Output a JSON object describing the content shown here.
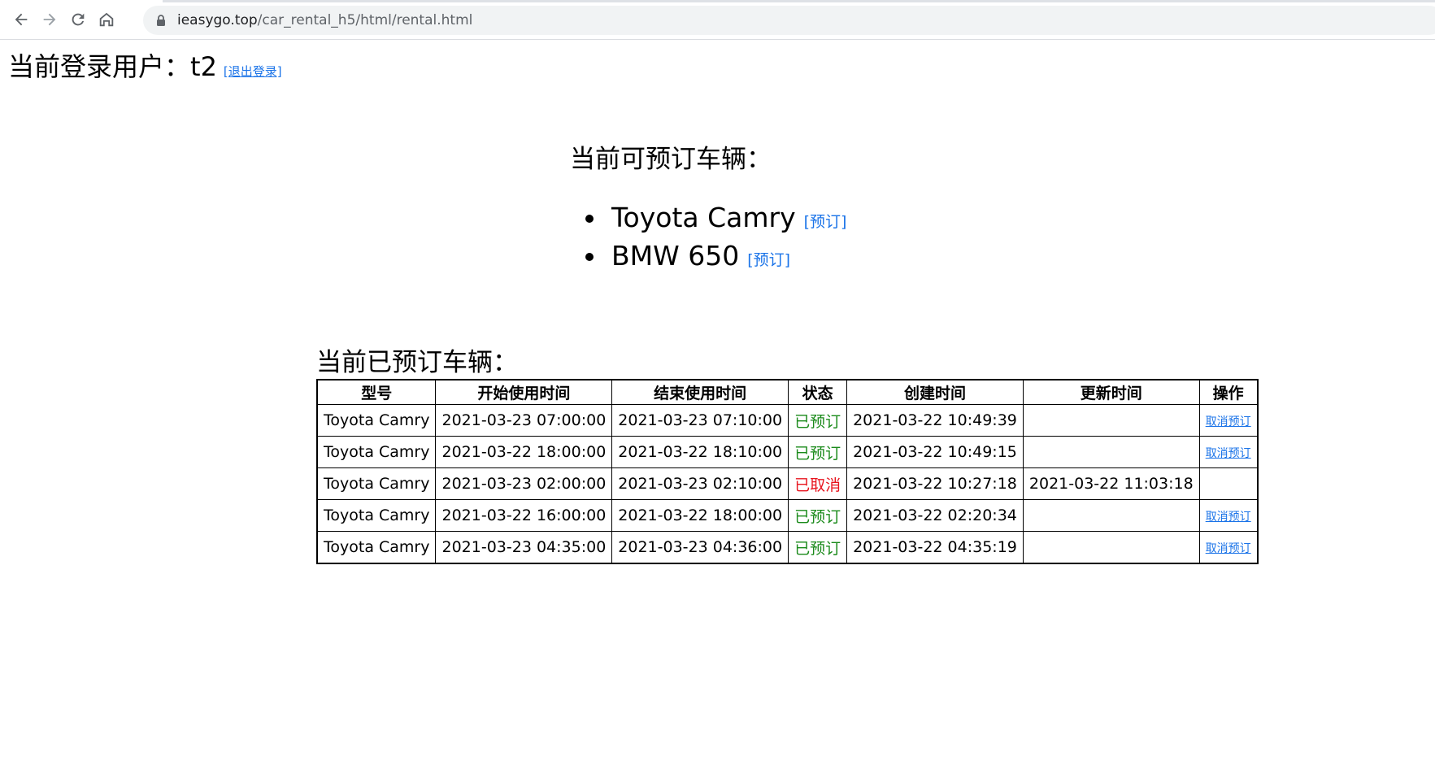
{
  "browser": {
    "url_host": "ieasygo.top",
    "url_path": "/car_rental_h5/html/rental.html",
    "icons": [
      "back-icon",
      "forward-icon",
      "reload-icon",
      "home-icon",
      "lock-icon"
    ]
  },
  "user": {
    "label": "当前登录用户：",
    "name": "t2",
    "logout_label": "[退出登录]"
  },
  "available": {
    "title": "当前可预订车辆：",
    "items": [
      {
        "name": "Toyota Camry",
        "action": "[预订]"
      },
      {
        "name": "BMW 650",
        "action": "[预订]"
      }
    ]
  },
  "booked": {
    "title": "当前已预订车辆：",
    "columns": [
      "型号",
      "开始使用时间",
      "结束使用时间",
      "状态",
      "创建时间",
      "更新时间",
      "操作"
    ],
    "rows": [
      {
        "model": "Toyota Camry",
        "start": "2021-03-23 07:00:00",
        "end": "2021-03-23 07:10:00",
        "status": "已预订",
        "created": "2021-03-22 10:49:39",
        "updated": "",
        "action": "取消预订"
      },
      {
        "model": "Toyota Camry",
        "start": "2021-03-22 18:00:00",
        "end": "2021-03-22 18:10:00",
        "status": "已预订",
        "created": "2021-03-22 10:49:15",
        "updated": "",
        "action": "取消预订"
      },
      {
        "model": "Toyota Camry",
        "start": "2021-03-23 02:00:00",
        "end": "2021-03-23 02:10:00",
        "status": "已取消",
        "created": "2021-03-22 10:27:18",
        "updated": "2021-03-22 11:03:18",
        "action": ""
      },
      {
        "model": "Toyota Camry",
        "start": "2021-03-22 16:00:00",
        "end": "2021-03-22 18:00:00",
        "status": "已预订",
        "created": "2021-03-22 02:20:34",
        "updated": "",
        "action": "取消预订"
      },
      {
        "model": "Toyota Camry",
        "start": "2021-03-23 04:35:00",
        "end": "2021-03-23 04:36:00",
        "status": "已预订",
        "created": "2021-03-22 04:35:19",
        "updated": "",
        "action": "取消预订"
      }
    ],
    "status_colors": {
      "已预订": "#1a8a1a",
      "已取消": "#e8141e"
    }
  },
  "colors": {
    "link": "#1a73e8",
    "omnibox": "#f1f3f4"
  }
}
